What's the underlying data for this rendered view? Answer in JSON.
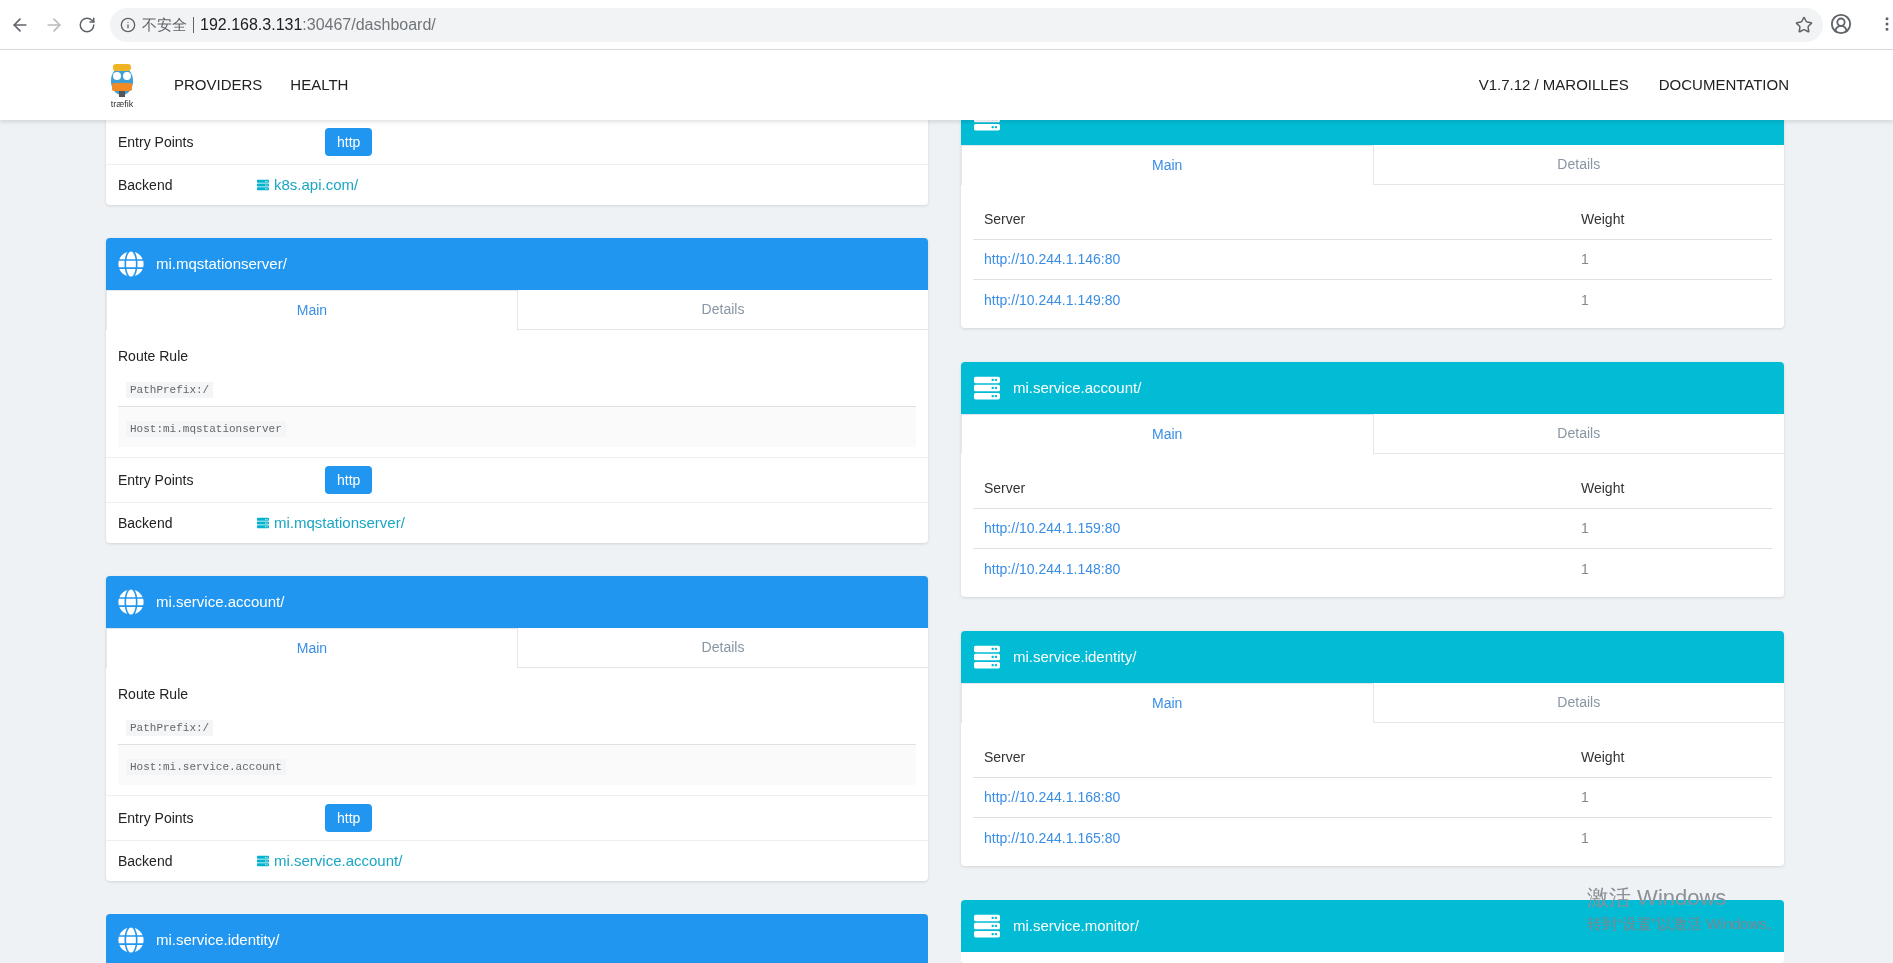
{
  "browser": {
    "security": "不安全",
    "host": "192.168.3.131",
    "path": ":30467/dashboard/"
  },
  "nav": {
    "logo_text": "træfik",
    "links": [
      {
        "label": "PROVIDERS"
      },
      {
        "label": "HEALTH"
      }
    ],
    "right_links": [
      {
        "label": "V1.7.12 / MAROILLES"
      },
      {
        "label": "DOCUMENTATION"
      }
    ]
  },
  "frontends": [
    {
      "kind": "rows_only",
      "entry_points_label": "Entry Points",
      "entry_points": [
        "http"
      ],
      "backend_label": "Backend",
      "backend": "k8s.api.com/"
    },
    {
      "kind": "full",
      "title": "mi.mqstationserver/",
      "tabs": [
        {
          "label": "Main",
          "selected": true
        },
        {
          "label": "Details",
          "selected": false
        }
      ],
      "route_rule_label": "Route Rule",
      "route_rules": [
        "PathPrefix:/",
        "Host:mi.mqstationserver"
      ],
      "entry_points_label": "Entry Points",
      "entry_points": [
        "http"
      ],
      "backend_label": "Backend",
      "backend": "mi.mqstationserver/"
    },
    {
      "kind": "full",
      "title": "mi.service.account/",
      "tabs": [
        {
          "label": "Main",
          "selected": true
        },
        {
          "label": "Details",
          "selected": false
        }
      ],
      "route_rule_label": "Route Rule",
      "route_rules": [
        "PathPrefix:/",
        "Host:mi.service.account"
      ],
      "entry_points_label": "Entry Points",
      "entry_points": [
        "http"
      ],
      "backend_label": "Backend",
      "backend": "mi.service.account/"
    },
    {
      "kind": "header_only",
      "title": "mi.service.identity/"
    }
  ],
  "backends": [
    {
      "kind": "cut_header",
      "tabs": [
        {
          "label": "Main",
          "selected": true
        },
        {
          "label": "Details",
          "selected": false
        }
      ],
      "columns": [
        "Server",
        "Weight"
      ],
      "servers": [
        {
          "url": "http://10.244.1.146:80",
          "weight": "1"
        },
        {
          "url": "http://10.244.1.149:80",
          "weight": "1"
        }
      ]
    },
    {
      "kind": "full",
      "title": "mi.service.account/",
      "tabs": [
        {
          "label": "Main",
          "selected": true
        },
        {
          "label": "Details",
          "selected": false
        }
      ],
      "columns": [
        "Server",
        "Weight"
      ],
      "servers": [
        {
          "url": "http://10.244.1.159:80",
          "weight": "1"
        },
        {
          "url": "http://10.244.1.148:80",
          "weight": "1"
        }
      ]
    },
    {
      "kind": "full",
      "title": "mi.service.identity/",
      "tabs": [
        {
          "label": "Main",
          "selected": true
        },
        {
          "label": "Details",
          "selected": false
        }
      ],
      "columns": [
        "Server",
        "Weight"
      ],
      "servers": [
        {
          "url": "http://10.244.1.168:80",
          "weight": "1"
        },
        {
          "url": "http://10.244.1.165:80",
          "weight": "1"
        }
      ]
    },
    {
      "kind": "header_only",
      "title": "mi.service.monitor/"
    }
  ],
  "os_notice": {
    "title": "激活 Windows",
    "text": "转到“设置”以激活 Windows。"
  }
}
